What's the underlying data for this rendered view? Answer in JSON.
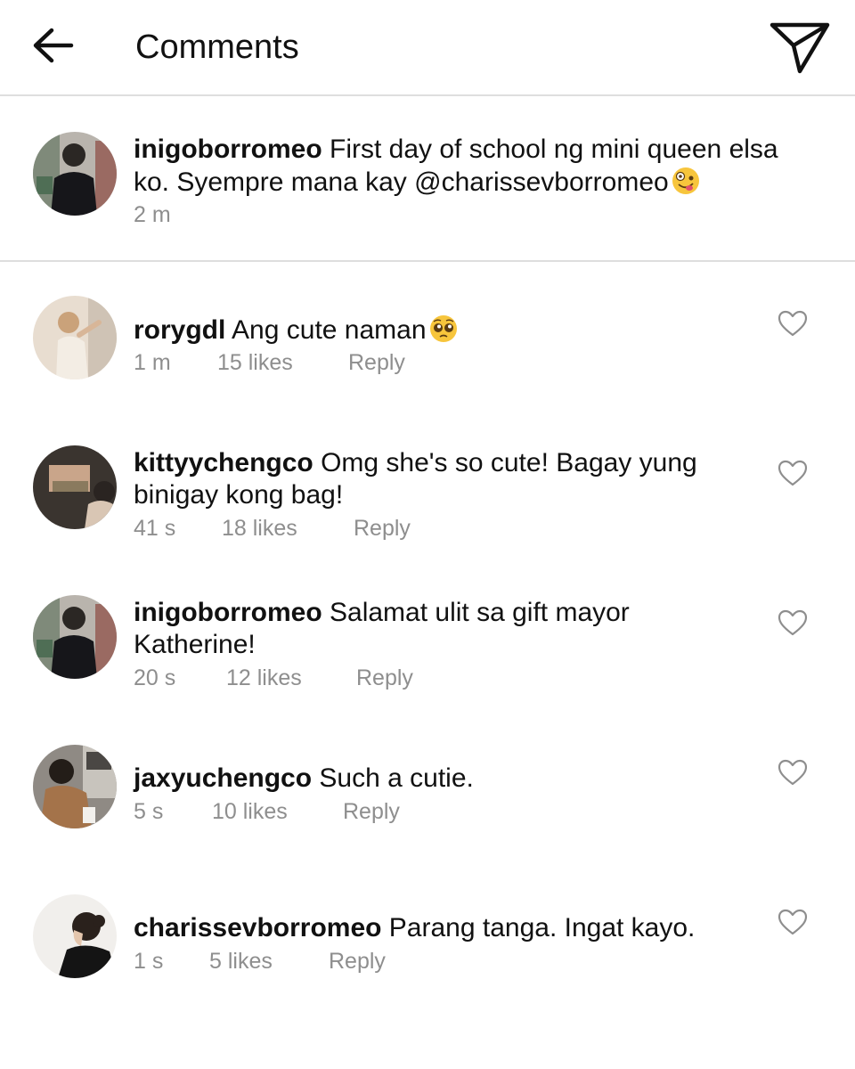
{
  "header": {
    "title": "Comments",
    "back_icon": "arrow-left-icon",
    "send_icon": "paper-plane-icon"
  },
  "caption": {
    "username": "inigoborromeo",
    "text_line1": "First day of school ng mini queen elsa",
    "text_line2_prefix": "ko. Syempre mana kay ",
    "mention": "@charissevborromeo",
    "emoji": "zany-face-emoji",
    "time": "2 m"
  },
  "comments": [
    {
      "username": "rorygdl",
      "text": "Ang cute naman",
      "emoji": "pleading-face-emoji",
      "time": "1 m",
      "likes": "15 likes",
      "reply": "Reply"
    },
    {
      "username": "kittyychengco",
      "text": "Omg she's so cute! Bagay yung",
      "text2": "binigay kong bag!",
      "time": "41 s",
      "likes": "18 likes",
      "reply": "Reply"
    },
    {
      "username": "inigoborromeo",
      "text": "Salamat ulit sa gift mayor",
      "text2": "Katherine!",
      "time": "20 s",
      "likes": "12 likes",
      "reply": "Reply"
    },
    {
      "username": "jaxyuchengco",
      "text": "Such a cutie.",
      "time": "5 s",
      "likes": "10 likes",
      "reply": "Reply"
    },
    {
      "username": "charissevborromeo",
      "text": "Parang tanga. Ingat kayo.",
      "time": "1 s",
      "likes": "5 likes",
      "reply": "Reply"
    }
  ],
  "colors": {
    "text": "#111111",
    "meta": "#8e8e8e",
    "divider": "#dedede",
    "background": "#ffffff"
  }
}
